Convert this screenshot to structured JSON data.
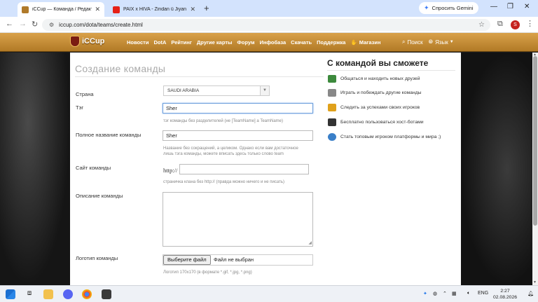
{
  "browser": {
    "tabs": [
      {
        "title": "iCCup — Команда / Редактир…",
        "active": true
      },
      {
        "title": "PAIX x HÏVA - Zindan ü Jiyan",
        "active": false
      }
    ],
    "gemini_label": "Спросить Gemini",
    "url": "iccup.com/dota/teams/create.html",
    "profile_letter": "S"
  },
  "site": {
    "logo": "iCCup",
    "nav": [
      "Новости",
      "DotA",
      "Рейтинг",
      "Другие карты",
      "Форум",
      "Инфобаза",
      "Скачать",
      "Поддержка"
    ],
    "shop": "Магазин",
    "search": "Поиск",
    "language": "Язык"
  },
  "form": {
    "heading": "Создание команды",
    "country_label": "Страна",
    "country_value": "SAUDI ARABIA",
    "tag_label": "Тэг",
    "tag_value": "Sher",
    "tag_hint": "тэг команды без разделителей (не [TeamName] а TeamName)",
    "fullname_label": "Полное название команды",
    "fullname_value": "Sher",
    "fullname_hint_1": "Название без сокращений, а целиком. Однако если вам достаточноe",
    "fullname_hint_2": "лишь тэга команды, можете вписать здесь только слово team",
    "site_label": "Сайт команды",
    "site_prefix": "http://",
    "site_value": "",
    "site_hint": "страничка клана без http:// (правда можно ничего и не писать)",
    "desc_label": "Описание команды",
    "desc_value": "",
    "logo_label": "Логотип команды",
    "file_button": "Выберите файл",
    "file_status": "Файл не выбран",
    "logo_hint": "Логотип 170x170 (в формате *.gif, *.jpg, *.png)"
  },
  "benefits": {
    "heading": "С командой вы сможете",
    "items": [
      {
        "text": "Общаться и находить новых друзей",
        "icon": "people-icon",
        "color": "#3d8a3d"
      },
      {
        "text": "Играть и побеждать другие команды",
        "icon": "sword-icon",
        "color": "#888888"
      },
      {
        "text": "Следить за успехами своих игроков",
        "icon": "lock-icon",
        "color": "#e0a11b"
      },
      {
        "text": "Бесплатно пользоваться хост-ботами",
        "icon": "robot-icon",
        "color": "#333333"
      },
      {
        "text": "Стать топовым игроком платформы и мира ;)",
        "icon": "globe-icon",
        "color": "#3a7fc8"
      }
    ]
  },
  "taskbar": {
    "lang": "ENG",
    "time": "2:27",
    "date": "02.08.2026"
  },
  "colors": {
    "brand": "#c48b35",
    "tab_bar": "#d3e3fd"
  }
}
